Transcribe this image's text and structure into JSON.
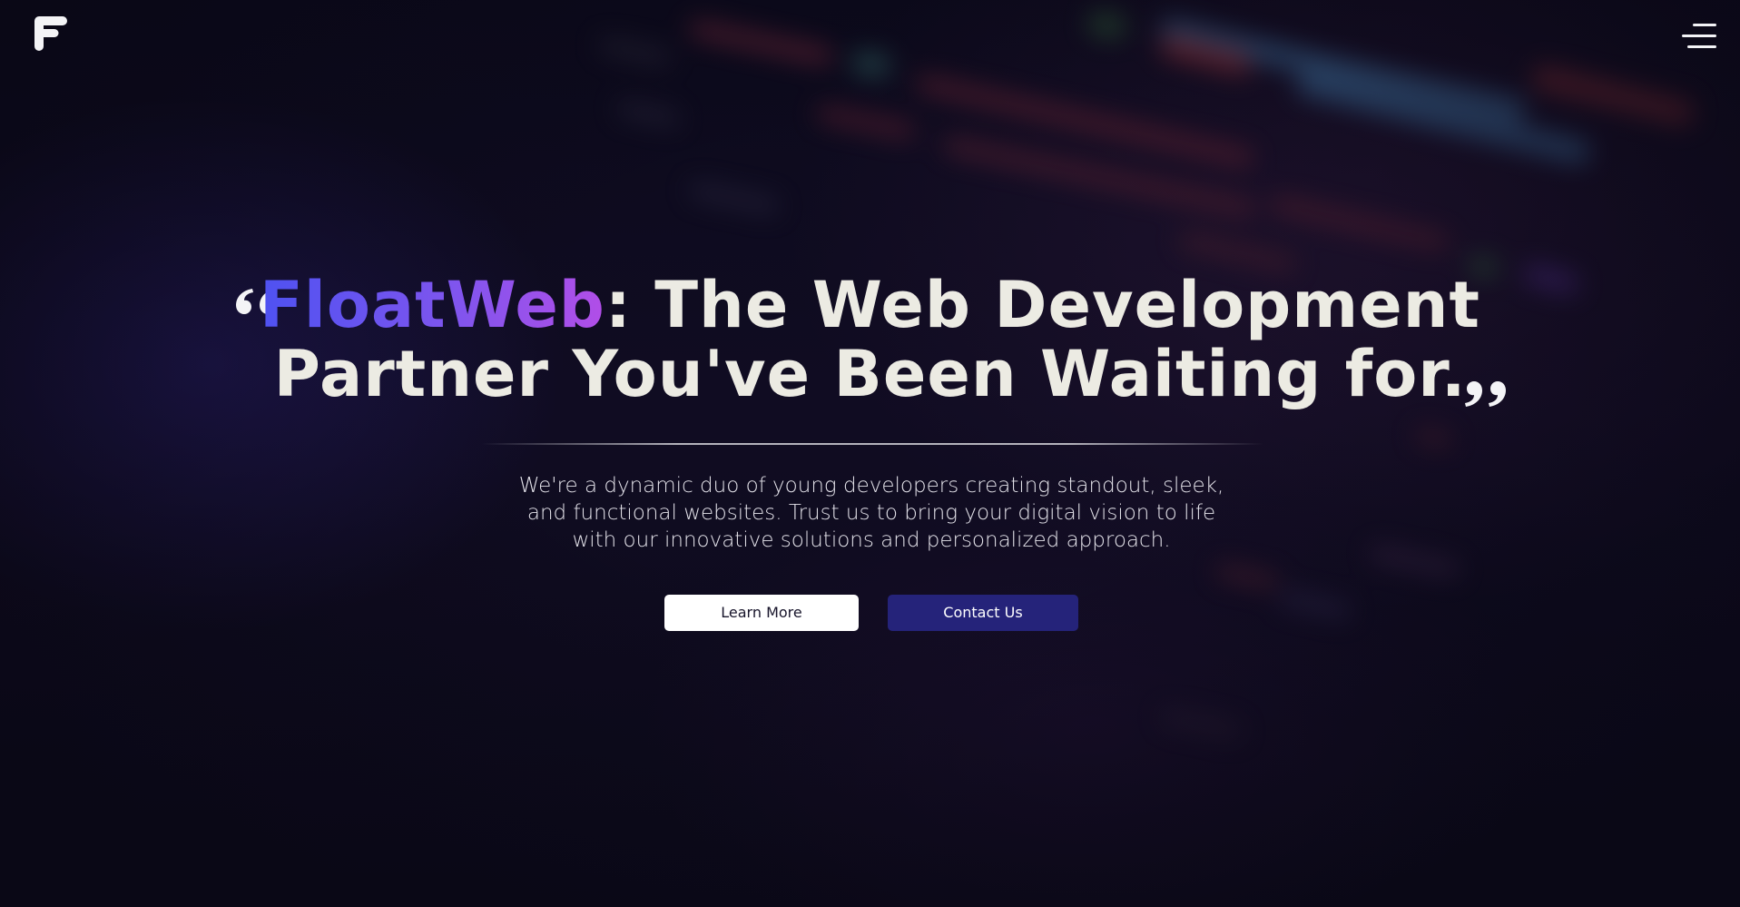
{
  "header": {
    "logo_icon": "floatweb-f-logo-icon",
    "menu_icon": "hamburger-menu-icon"
  },
  "hero": {
    "headline_brand": "FloatWeb",
    "headline_line1_rest": ": The Web Development",
    "headline_line2": "Partner You've Been Waiting for.",
    "quote_open_icon": "open-quote-icon",
    "quote_close_icon": "close-quote-icon",
    "subtitle_line1": "We're a dynamic duo of young developers creating standout, sleek,",
    "subtitle_line2": "and functional websites. Trust us to bring your digital vision to life",
    "subtitle_line3": "with our innovative solutions and personalized approach.",
    "learn_more_label": "Learn More",
    "contact_label": "Contact Us"
  },
  "colors": {
    "background": "#0b0918",
    "brand_gradient_start": "#4e52f1",
    "brand_gradient_end": "#b24ee8",
    "headline_text": "#ecebe3",
    "contact_button": "#25237a",
    "learn_button": "#ffffff"
  }
}
